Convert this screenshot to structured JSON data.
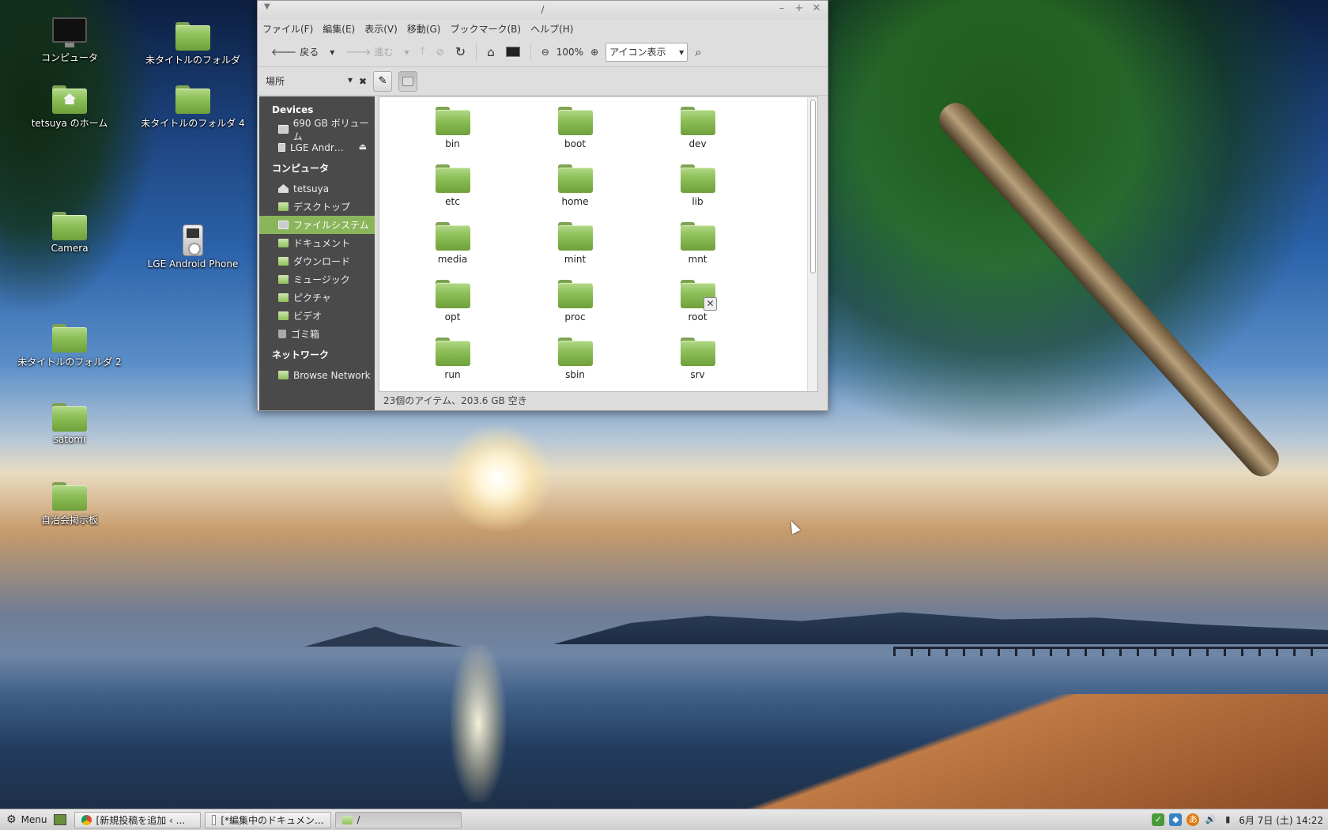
{
  "desktop": {
    "icons": [
      {
        "label": "コンピュータ",
        "icon": "computer-icon"
      },
      {
        "label": "未タイトルのフォルダ",
        "icon": "folder-icon"
      },
      {
        "label": "tetsuya のホーム",
        "icon": "home-folder-icon"
      },
      {
        "label": "未タイトルのフォルダ 4",
        "icon": "folder-icon"
      },
      {
        "label": "Camera",
        "icon": "folder-icon"
      },
      {
        "label": "LGE Android Phone",
        "icon": "media-player-icon"
      },
      {
        "label": "未タイトルのフォルダ 2",
        "icon": "folder-icon"
      },
      {
        "label": "satomi",
        "icon": "folder-icon"
      },
      {
        "label": "自治会掲示板",
        "icon": "folder-icon"
      }
    ]
  },
  "window": {
    "title": "/",
    "menu": [
      "ファイル(F)",
      "編集(E)",
      "表示(V)",
      "移動(G)",
      "ブックマーク(B)",
      "ヘルプ(H)"
    ],
    "toolbar": {
      "back": "戻る",
      "forward": "進む",
      "zoom": "100%",
      "view_mode": "アイコン表示"
    },
    "location": {
      "selector": "場所"
    },
    "sidebar": {
      "devices_heading": "Devices",
      "devices": [
        {
          "label": "690 GB ボリューム"
        },
        {
          "label": "LGE Andr…"
        }
      ],
      "computer_heading": "コンピュータ",
      "computer": [
        {
          "label": "tetsuya"
        },
        {
          "label": "デスクトップ"
        },
        {
          "label": "ファイルシステム"
        },
        {
          "label": "ドキュメント"
        },
        {
          "label": "ダウンロード"
        },
        {
          "label": "ミュージック"
        },
        {
          "label": "ピクチャ"
        },
        {
          "label": "ビデオ"
        },
        {
          "label": "ゴミ箱"
        }
      ],
      "network_heading": "ネットワーク",
      "network": [
        {
          "label": "Browse Network"
        }
      ]
    },
    "files": [
      "bin",
      "boot",
      "dev",
      "etc",
      "home",
      "lib",
      "media",
      "mint",
      "mnt",
      "opt",
      "proc",
      "root",
      "run",
      "sbin",
      "srv"
    ],
    "status": "23個のアイテム、203.6 GB 空き"
  },
  "taskbar": {
    "menu_label": "Menu",
    "windows": [
      {
        "label": "[新規投稿を追加 ‹ ..."
      },
      {
        "label": "[*編集中のドキュメン..."
      },
      {
        "label": "/"
      }
    ],
    "clock": "6月 7日 (土) 14:22"
  },
  "colors": {
    "folder_green": "#8ec059",
    "sidebar_bg": "#4a4a4a",
    "sidebar_selected": "#8bb55a"
  }
}
